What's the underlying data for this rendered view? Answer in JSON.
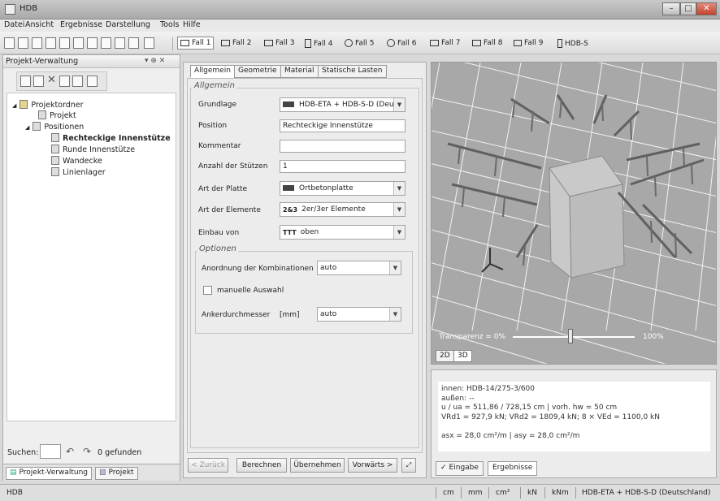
{
  "window": {
    "title": "HDB",
    "minimize": "–",
    "maximize": "□",
    "close": "✕"
  },
  "menu": [
    "Datei",
    "Ansicht",
    "Ergebnisse",
    "Darstellung",
    "Tools",
    "Hilfe"
  ],
  "toolbar": {
    "cases": [
      "Fall 1",
      "Fall 2",
      "Fall 3",
      "Fall 4",
      "Fall 5",
      "Fall 6",
      "Fall 7",
      "Fall 8",
      "Fall 9",
      "HDB-S"
    ],
    "active_case": "Fall 1"
  },
  "left_panel": {
    "title": "Projekt-Verwaltung",
    "pin": "▾ ⊕ ✕",
    "tree": {
      "root": "Projektordner",
      "project": "Projekt",
      "positions": "Positionen",
      "items": [
        "Rechteckige Innenstütze",
        "Runde Innenstütze",
        "Wandecke",
        "Linienlager"
      ],
      "selected": "Rechteckige Innenstütze"
    },
    "search_label": "Suchen:",
    "search_value": "",
    "found": "0 gefunden",
    "tabs": [
      "Projekt-Verwaltung",
      "Projekt"
    ]
  },
  "center": {
    "tabs": [
      "Allgemein",
      "Geometrie",
      "Material",
      "Statische Lasten"
    ],
    "active_tab": "Allgemein",
    "group_general": "Allgemein",
    "fields": {
      "grundlage": {
        "label": "Grundlage",
        "value": "HDB-ETA + HDB-S-D (Deu"
      },
      "position": {
        "label": "Position",
        "value": "Rechteckige Innenstütze"
      },
      "kommentar": {
        "label": "Kommentar",
        "value": ""
      },
      "anzahl": {
        "label": "Anzahl der Stützen",
        "value": "1"
      },
      "platte": {
        "label": "Art der Platte",
        "value": "Ortbetonplatte"
      },
      "elemente": {
        "label": "Art der Elemente",
        "value": "2er/3er Elemente",
        "icon": "2&3"
      },
      "einbau": {
        "label": "Einbau von",
        "value": "oben",
        "icon": "TTT"
      }
    },
    "group_options": "Optionen",
    "options": {
      "anordnung": {
        "label": "Anordnung der Kombinationen",
        "value": "auto"
      },
      "manual": {
        "label": "manuelle Auswahl",
        "checked": false
      },
      "anker": {
        "label": "Ankerdurchmesser",
        "unit": "[mm]",
        "value": "auto"
      }
    },
    "buttons": {
      "back": "< Zurück",
      "calc": "Berechnen",
      "apply": "Übernehmen",
      "forward": "Vorwärts >"
    }
  },
  "viewer": {
    "transparency_label": "Transparenz = 0%",
    "transparency": 0.47,
    "max_label": "100%",
    "view_buttons": [
      "2D",
      "3D"
    ]
  },
  "results": {
    "lines": [
      "innen: HDB-14/275-3/600",
      "außen: --",
      "u / ua = 511,86 / 728,15 cm | vorh. hw = 50 cm",
      "VRd1 = 927,9 kN; VRd2 = 1809,4 kN; 8 × VEd = 1100,0 kN",
      "",
      "asx = 28,0 cm²/m | asy = 28,0 cm²/m"
    ],
    "tabs": [
      "Eingabe",
      "Ergebnisse"
    ],
    "active_tab": "Ergebnisse"
  },
  "status": {
    "left": "HDB",
    "units": [
      "cm",
      "mm",
      "cm²",
      "kN",
      "kNm",
      "HDB-ETA + HDB-S-D (Deutschland)"
    ]
  }
}
